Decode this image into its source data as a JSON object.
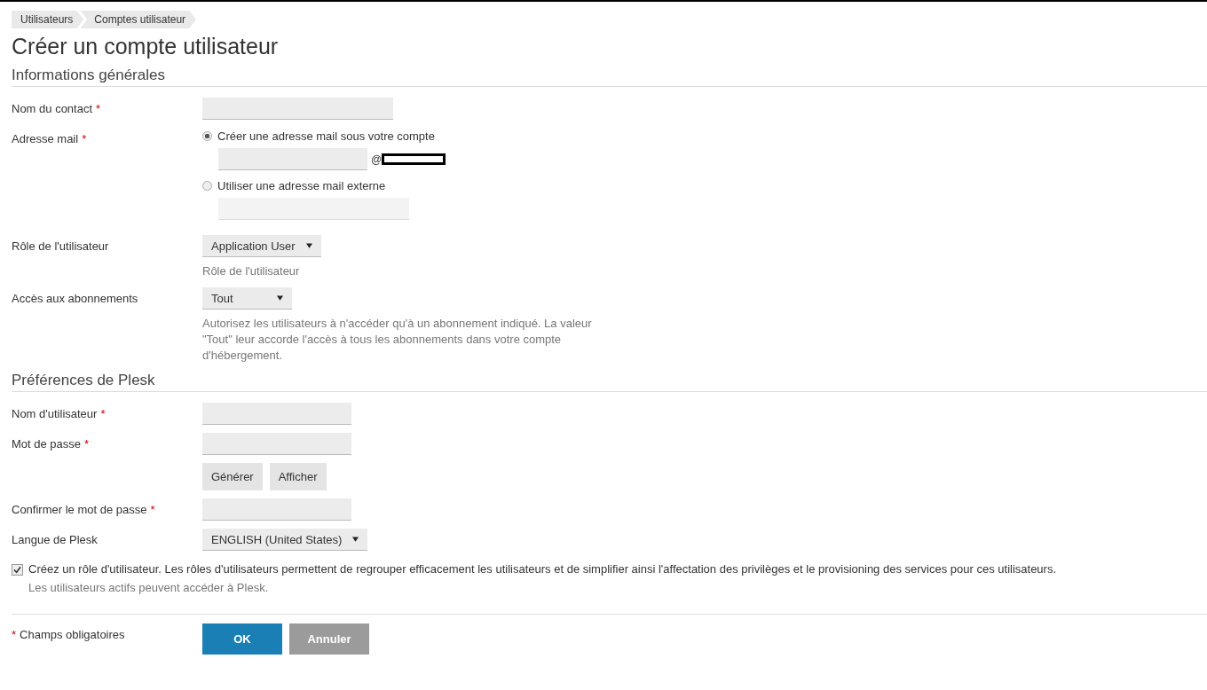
{
  "breadcrumbs": [
    {
      "label": "Utilisateurs"
    },
    {
      "label": "Comptes utilisateur"
    }
  ],
  "title": "Créer un compte utilisateur",
  "sections": [
    {
      "heading": "Informations générales",
      "fields": [
        {
          "kind": "text",
          "label": "Nom du contact",
          "required_mark": "*"
        },
        {
          "kind": "radio_group",
          "label": "Adresse mail",
          "required_mark": "*",
          "options": [
            {
              "label": "Créer une adresse mail sous votre compte",
              "selected": true,
              "suffix": "@",
              "redacted": true
            },
            {
              "label": "Utiliser une adresse mail externe",
              "selected": false
            }
          ]
        },
        {
          "kind": "select",
          "label": "Rôle de l'utilisateur",
          "value": "Application User",
          "hint": "Rôle de l'utilisateur"
        },
        {
          "kind": "select",
          "label": "Accès aux abonnements",
          "value": "Tout",
          "hint": "Autorisez les utilisateurs à n'accéder qu'à un abonnement indiqué. La valeur \"Tout\" leur accorde l'accès à tous les abonnements dans votre compte d'hébergement."
        }
      ]
    },
    {
      "heading": "Préférences de Plesk",
      "fields": [
        {
          "kind": "text",
          "label": "Nom d'utilisateur",
          "required_mark": "*"
        },
        {
          "kind": "text",
          "label": "Mot de passe",
          "required_mark": "*",
          "buttons": [
            "Générer",
            "Afficher"
          ]
        },
        {
          "kind": "text",
          "label": "Confirmer le mot de passe",
          "required_mark": "*"
        },
        {
          "kind": "select",
          "label": "Langue de Plesk",
          "value": "ENGLISH (United States)"
        }
      ]
    }
  ],
  "checkbox": {
    "checked": true,
    "label": "Créez un rôle d'utilisateur. Les rôles d'utilisateurs permettent de regrouper efficacement les utilisateurs et de simplifier ainsi l'affectation des privilèges et le provisioning des services pour ces utilisateurs.",
    "hint": "Les utilisateurs actifs peuvent accéder à Plesk."
  },
  "footer": {
    "required_mark": "*",
    "note": "Champs obligatoires",
    "buttons": [
      {
        "label": "OK",
        "kind": "primary"
      },
      {
        "label": "Annuler",
        "kind": "secondary"
      }
    ]
  }
}
